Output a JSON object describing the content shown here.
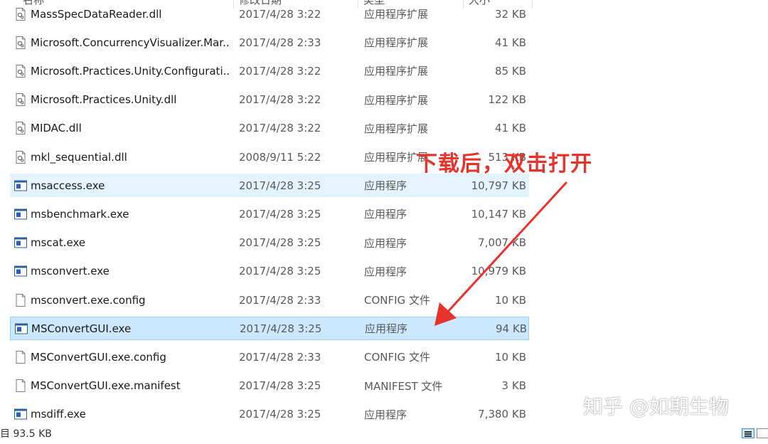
{
  "columns": {
    "name": "名称",
    "date": "修改日期",
    "type": "类型",
    "size": "大小"
  },
  "files": [
    {
      "name": "MassSpecDataReader.dll",
      "date": "2017/4/28 3:22",
      "type": "应用程序扩展",
      "size": "32 KB",
      "icon": "dll-file-icon",
      "state": "normal"
    },
    {
      "name": "Microsoft.ConcurrencyVisualizer.Mar...",
      "date": "2017/4/28 2:33",
      "type": "应用程序扩展",
      "size": "41 KB",
      "icon": "dll-file-icon",
      "state": "normal"
    },
    {
      "name": "Microsoft.Practices.Unity.Configurati...",
      "date": "2017/4/28 3:22",
      "type": "应用程序扩展",
      "size": "85 KB",
      "icon": "dll-file-icon",
      "state": "normal"
    },
    {
      "name": "Microsoft.Practices.Unity.dll",
      "date": "2017/4/28 3:22",
      "type": "应用程序扩展",
      "size": "122 KB",
      "icon": "dll-file-icon",
      "state": "normal"
    },
    {
      "name": "MIDAC.dll",
      "date": "2017/4/28 3:22",
      "type": "应用程序扩展",
      "size": "41 KB",
      "icon": "dll-file-icon",
      "state": "normal"
    },
    {
      "name": "mkl_sequential.dll",
      "date": "2008/9/11 5:22",
      "type": "应用程序扩展",
      "size": "513 KB",
      "icon": "dll-file-icon",
      "state": "normal"
    },
    {
      "name": "msaccess.exe",
      "date": "2017/4/28 3:25",
      "type": "应用程序",
      "size": "10,797 KB",
      "icon": "exe-file-icon",
      "state": "hover"
    },
    {
      "name": "msbenchmark.exe",
      "date": "2017/4/28 3:25",
      "type": "应用程序",
      "size": "10,147 KB",
      "icon": "exe-file-icon",
      "state": "normal"
    },
    {
      "name": "mscat.exe",
      "date": "2017/4/28 3:25",
      "type": "应用程序",
      "size": "7,007 KB",
      "icon": "exe-file-icon",
      "state": "normal"
    },
    {
      "name": "msconvert.exe",
      "date": "2017/4/28 3:25",
      "type": "应用程序",
      "size": "10,979 KB",
      "icon": "exe-file-icon",
      "state": "normal"
    },
    {
      "name": "msconvert.exe.config",
      "date": "2017/4/28 2:33",
      "type": "CONFIG 文件",
      "size": "10 KB",
      "icon": "blank-file-icon",
      "state": "normal"
    },
    {
      "name": "MSConvertGUI.exe",
      "date": "2017/4/28 3:25",
      "type": "应用程序",
      "size": "94 KB",
      "icon": "exe-file-icon",
      "state": "selected"
    },
    {
      "name": "MSConvertGUI.exe.config",
      "date": "2017/4/28 2:33",
      "type": "CONFIG 文件",
      "size": "10 KB",
      "icon": "blank-file-icon",
      "state": "normal"
    },
    {
      "name": "MSConvertGUI.exe.manifest",
      "date": "2017/4/28 3:25",
      "type": "MANIFEST 文件",
      "size": "3 KB",
      "icon": "blank-file-icon",
      "state": "normal"
    },
    {
      "name": "msdiff.exe",
      "date": "2017/4/28 3:25",
      "type": "应用程序",
      "size": "7,380 KB",
      "icon": "exe-file-icon",
      "state": "normal"
    }
  ],
  "annotation": {
    "text": "下载后，双击打开",
    "color": "#e8332a"
  },
  "watermark": {
    "text": "知乎 @如期生物"
  },
  "status": {
    "text": "目 93.5 KB"
  },
  "colors": {
    "selected_bg": "#cce8ff",
    "selected_border": "#99d1ff",
    "hover_bg": "#e5f3ff",
    "arrow": "#e8332a"
  }
}
